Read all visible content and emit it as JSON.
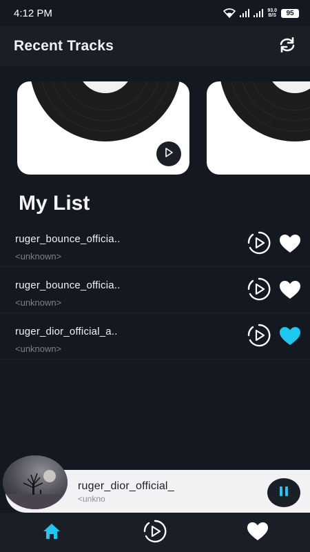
{
  "status_bar": {
    "time": "4:12 PM",
    "speed_top": "93.0",
    "speed_bottom": "B/S",
    "battery": "95"
  },
  "header": {
    "title": "Recent Tracks",
    "refresh_icon": "refresh-icon"
  },
  "recent_tracks": [
    {
      "art": "vinyl-record",
      "play_icon": "play-icon"
    },
    {
      "art": "vinyl-record"
    }
  ],
  "my_list": {
    "title": "My List",
    "tracks": [
      {
        "name": "ruger_bounce_officia..",
        "artist": "<unknown>",
        "favorite": false
      },
      {
        "name": "ruger_bounce_officia..",
        "artist": "<unknown>",
        "favorite": false
      },
      {
        "name": "ruger_dior_official_a..",
        "artist": "<unknown>",
        "favorite": true
      }
    ]
  },
  "mini_player": {
    "title": "ruger_dior_official_",
    "artist": "<unkno",
    "state_icon": "pause-icon"
  },
  "bottom_nav": [
    {
      "icon": "home-icon",
      "active": true
    },
    {
      "icon": "play-circle-icon",
      "active": false
    },
    {
      "icon": "heart-icon",
      "active": false
    }
  ],
  "colors": {
    "background": "#141820",
    "header": "#1a1e27",
    "accent": "#1ec7f0",
    "text": "#f2f2f2",
    "muted": "#7d808a"
  }
}
